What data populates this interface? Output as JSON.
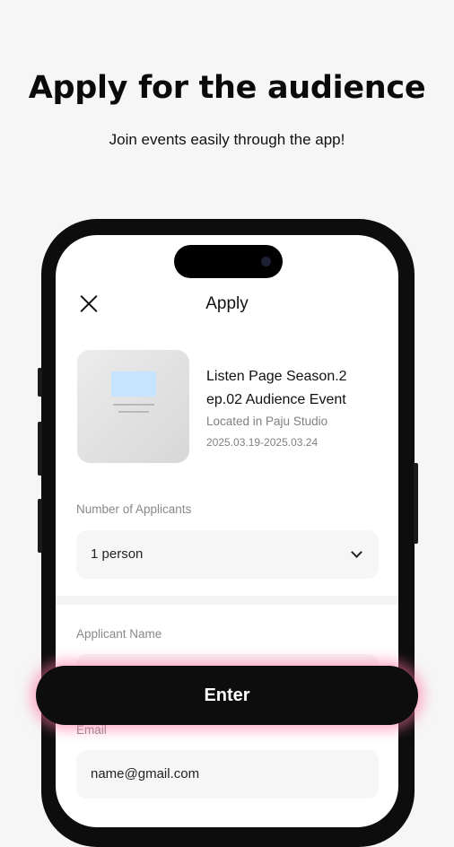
{
  "promo": {
    "headline": "Apply for the audience",
    "subline": "Join events easily through the app!"
  },
  "screen": {
    "title": "Apply",
    "event": {
      "title": "Listen Page Season.2 ep.02 Audience Event",
      "location": "Located in Paju Studio",
      "dates": "2025.03.19-2025.03.24"
    },
    "applicants": {
      "label": "Number of Applicants",
      "value": "1 person"
    },
    "name_field": {
      "label": "Applicant Name"
    },
    "email_field": {
      "label": "Email",
      "value": "name@gmail.com"
    },
    "enter_label": "Enter"
  },
  "colors": {
    "button_bg": "#0d0d0d",
    "button_glow": "#ff73a0",
    "field_bg": "#f6f6f6"
  }
}
